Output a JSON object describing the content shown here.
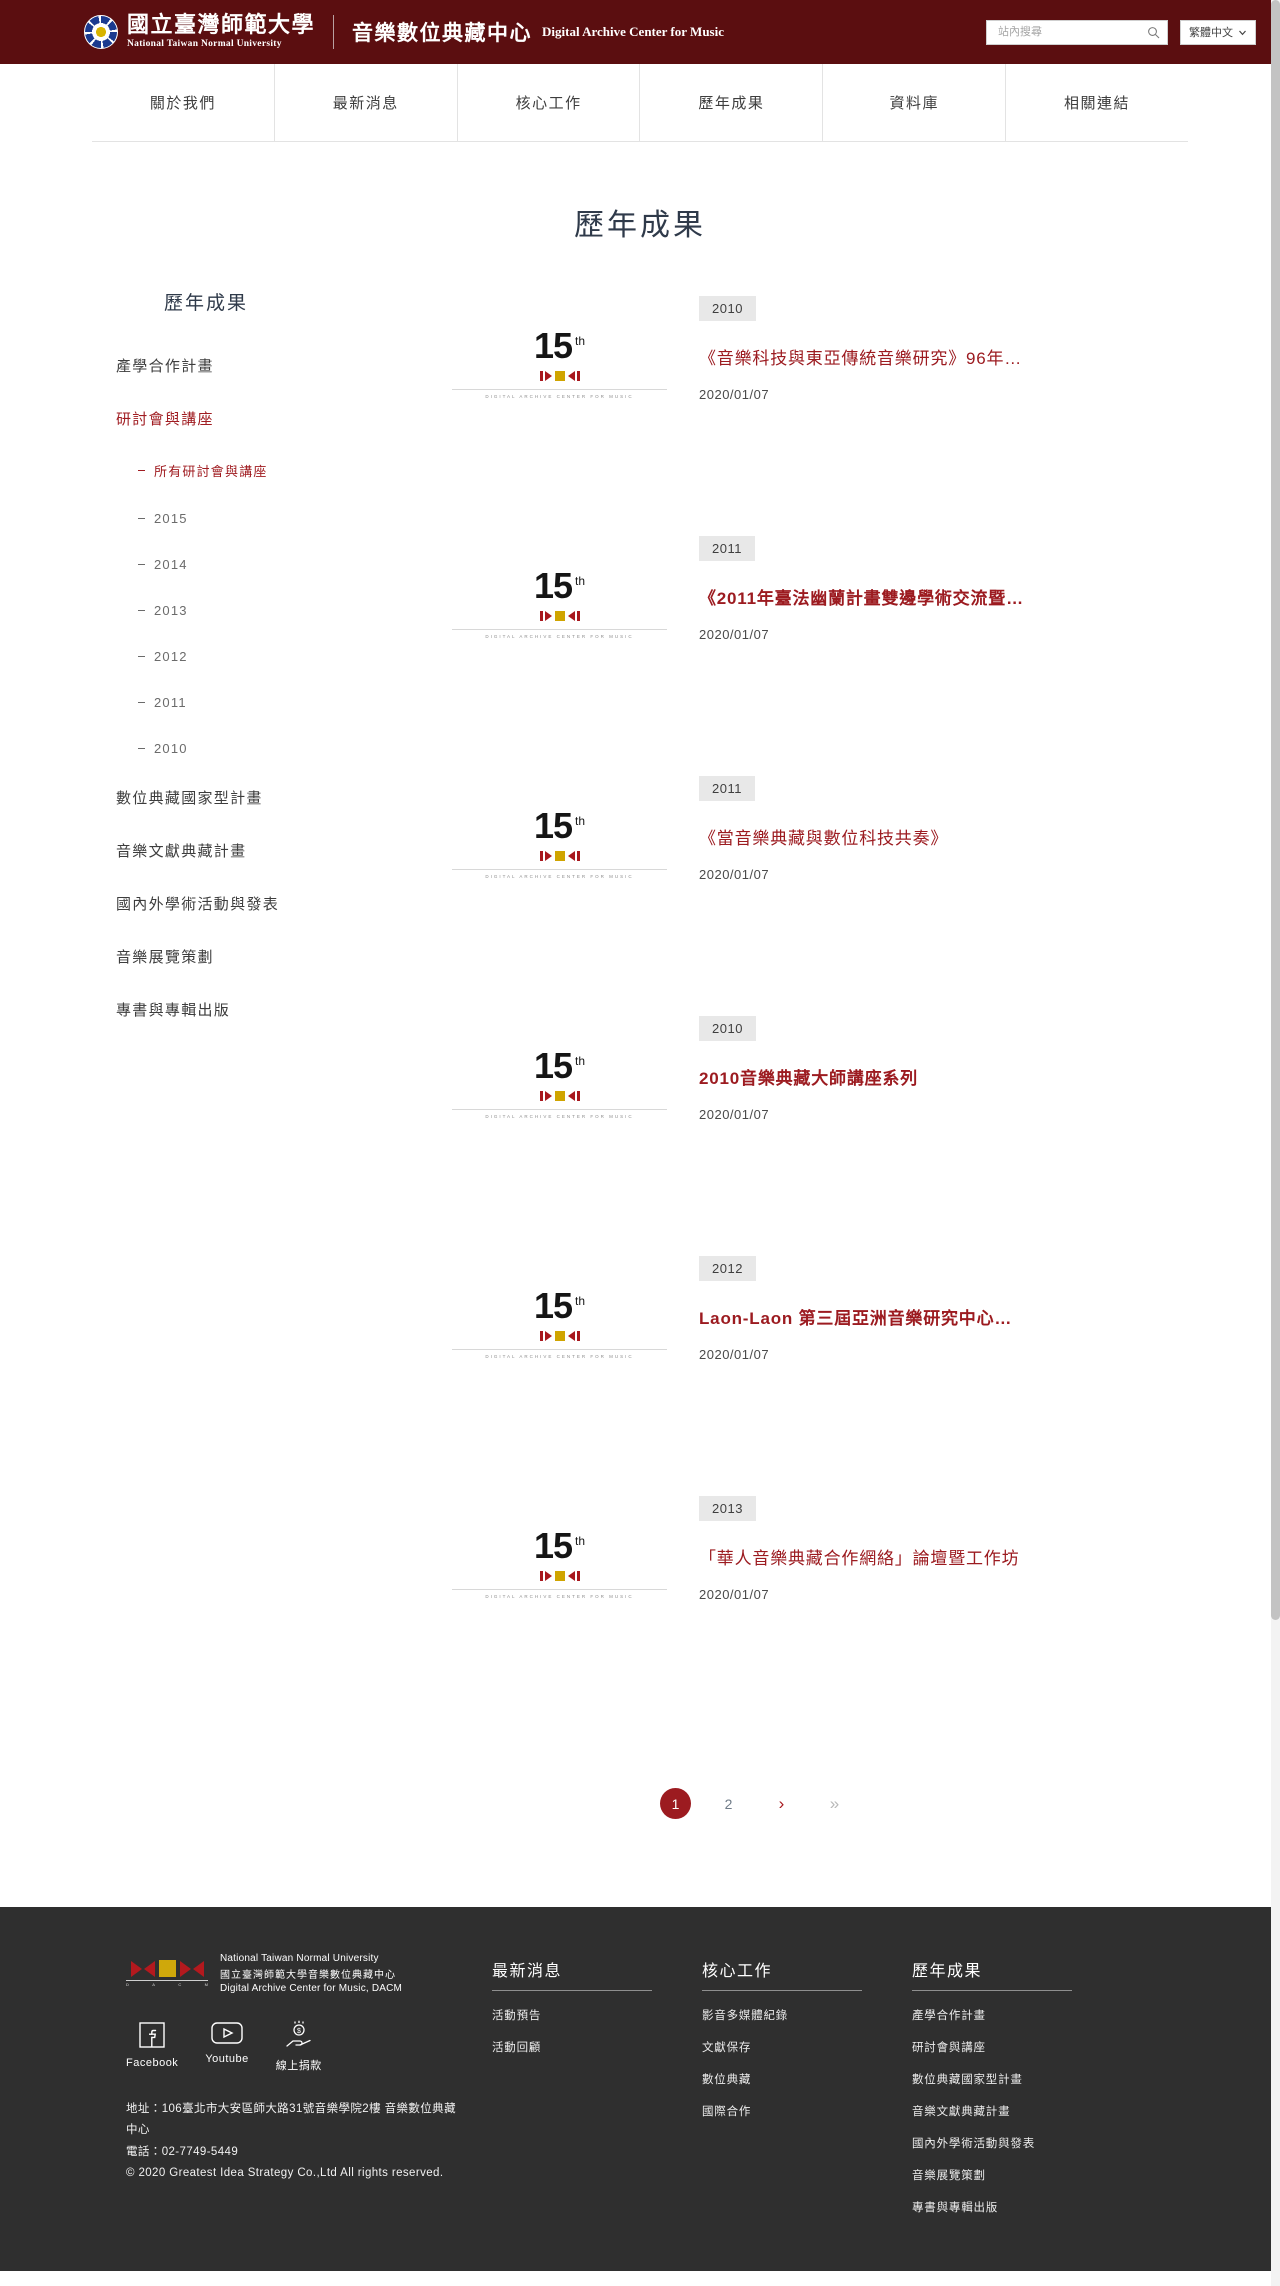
{
  "header": {
    "university_cn": "國立臺灣師範大學",
    "university_en": "National Taiwan Normal University",
    "site_cn": "音樂數位典藏中心",
    "site_en": "Digital Archive Center for Music",
    "search_placeholder": "站內搜尋",
    "search_value": "",
    "language": "繁體中文"
  },
  "nav": {
    "items": [
      {
        "label": "關於我們"
      },
      {
        "label": "最新消息"
      },
      {
        "label": "核心工作"
      },
      {
        "label": "歷年成果"
      },
      {
        "label": "資料庫"
      },
      {
        "label": "相關連結"
      }
    ]
  },
  "page": {
    "title": "歷年成果"
  },
  "sidebar": {
    "title": "歷年成果",
    "items": [
      {
        "label": "產學合作計畫",
        "active": false
      },
      {
        "label": "研討會與講座",
        "active": true
      }
    ],
    "subitems": [
      {
        "label": "所有研討會與講座",
        "active": true
      },
      {
        "label": "2015",
        "active": false
      },
      {
        "label": "2014",
        "active": false
      },
      {
        "label": "2013",
        "active": false
      },
      {
        "label": "2012",
        "active": false
      },
      {
        "label": "2011",
        "active": false
      },
      {
        "label": "2010",
        "active": false
      }
    ],
    "items_after": [
      {
        "label": "數位典藏國家型計畫"
      },
      {
        "label": "音樂文獻典藏計畫"
      },
      {
        "label": "國內外學術活動與發表"
      },
      {
        "label": "音樂展覽策劃"
      },
      {
        "label": "專書與專輯出版"
      }
    ]
  },
  "thumb": {
    "number": "15",
    "ordinal": "th",
    "caption": "DIGITAL ARCHIVE CENTER FOR MUSIC"
  },
  "list": {
    "rows": [
      {
        "year": "2010",
        "title": "《音樂科技與東亞傳統音樂研究》96年…",
        "date": "2020/01/07",
        "bold": false
      },
      {
        "year": "2011",
        "title": "《2011年臺法幽蘭計畫雙邊學術交流暨…",
        "date": "2020/01/07",
        "bold": true
      },
      {
        "year": "2011",
        "title": "《當音樂典藏與數位科技共奏》",
        "date": "2020/01/07",
        "bold": false
      },
      {
        "year": "2010",
        "title": "2010音樂典藏大師講座系列",
        "date": "2020/01/07",
        "bold": true
      },
      {
        "year": "2012",
        "title": "Laon-Laon 第三屆亞洲音樂研究中心…",
        "date": "2020/01/07",
        "bold": true
      },
      {
        "year": "2013",
        "title": "「華人音樂典藏合作網絡」論壇暨工作坊",
        "date": "2020/01/07",
        "bold": false
      }
    ]
  },
  "pagination": {
    "pages": [
      {
        "label": "1",
        "active": true,
        "kind": "page"
      },
      {
        "label": "2",
        "active": false,
        "kind": "page"
      },
      {
        "label": "›",
        "active": false,
        "kind": "next"
      },
      {
        "label": "»",
        "active": false,
        "kind": "last"
      }
    ]
  },
  "footer": {
    "logo": {
      "line1": "National Taiwan Normal University",
      "line2": "國立臺灣師範大學音樂數位典藏中心",
      "line3": "Digital Archive Center for Music, DACM",
      "mark_letters": [
        "D",
        "A",
        "C",
        "M"
      ]
    },
    "socials": [
      {
        "label": "Facebook",
        "icon": "facebook-icon"
      },
      {
        "label": "Youtube",
        "icon": "youtube-icon"
      },
      {
        "label": "線上捐款",
        "icon": "donate-icon"
      }
    ],
    "address": "地址：106臺北市大安區師大路31號音樂學院2樓 音樂數位典藏中心",
    "phone": "電話：02-7749-5449",
    "copyright": "© 2020 Greatest Idea Strategy Co.,Ltd All rights reserved.",
    "columns": [
      {
        "title": "最新消息",
        "links": [
          {
            "label": "活動預告"
          },
          {
            "label": "活動回顧"
          }
        ]
      },
      {
        "title": "核心工作",
        "links": [
          {
            "label": "影音多媒體紀錄"
          },
          {
            "label": "文獻保存"
          },
          {
            "label": "數位典藏"
          },
          {
            "label": "國際合作"
          }
        ]
      },
      {
        "title": "歷年成果",
        "links": [
          {
            "label": "產學合作計畫"
          },
          {
            "label": "研討會與講座"
          },
          {
            "label": "數位典藏國家型計畫"
          },
          {
            "label": "音樂文獻典藏計畫"
          },
          {
            "label": "國內外學術活動與發表"
          },
          {
            "label": "音樂展覽策劃"
          },
          {
            "label": "專書與專輯出版"
          }
        ]
      }
    ]
  },
  "colors": {
    "brand_maroon": "#5b0e10",
    "accent_red": "#9c1b20",
    "footer_bg": "#2f2f2f",
    "gold": "#d0a400"
  }
}
